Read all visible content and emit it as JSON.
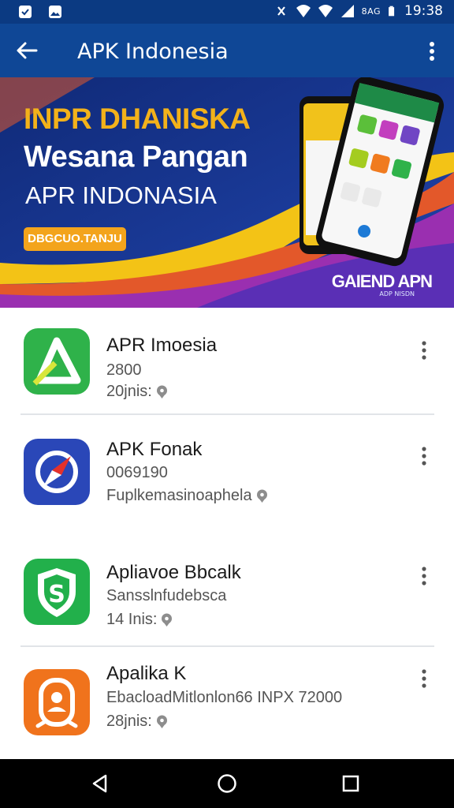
{
  "status_bar": {
    "left_icons": [
      "notification-check-icon",
      "gallery-icon"
    ],
    "right_icons": [
      "mute-icon",
      "wifi-icon",
      "signal-icon",
      "signal-icon",
      "battery-icon"
    ],
    "network_label": "8AG",
    "time": "19:38"
  },
  "app_bar": {
    "title": "APK Indonesia",
    "back_icon": "arrow-left-icon",
    "menu_icon": "more-vert-icon"
  },
  "banner": {
    "line1": "INPR DHANISKA",
    "line2": "Wesana Pangan",
    "line3": "APR INDONASIA",
    "button_label": "DBGCUO.TANJU",
    "brand": "GAIEND APN",
    "brand_sub": "ADP  NISDN"
  },
  "apps": [
    {
      "name": "APR Imoesia",
      "subtitle": "2800",
      "meta": "20jnis:",
      "icon": "triangle-logo-icon",
      "icon_color": "#2fb24a"
    },
    {
      "name": "APK Fonak",
      "subtitle": "0069190",
      "meta": "Fuplkemasinoaphela",
      "icon": "compass-icon",
      "icon_color": "#2a47b8"
    },
    {
      "name": "Apliavoe Bbcalk",
      "subtitle": "Sansslnfudebsca",
      "meta": "14 Inis:",
      "icon": "shield-dollar-icon",
      "icon_color": "#22b04b"
    },
    {
      "name": "Apalika K",
      "subtitle": "EbacloadMitlonlon66 INPX 72000",
      "meta": "28jnis:",
      "icon": "person-badge-icon",
      "icon_color": "#f0731c"
    }
  ],
  "nav": {
    "back_icon": "back-triangle-icon",
    "home_icon": "home-circle-icon",
    "recents_icon": "recents-square-icon"
  }
}
